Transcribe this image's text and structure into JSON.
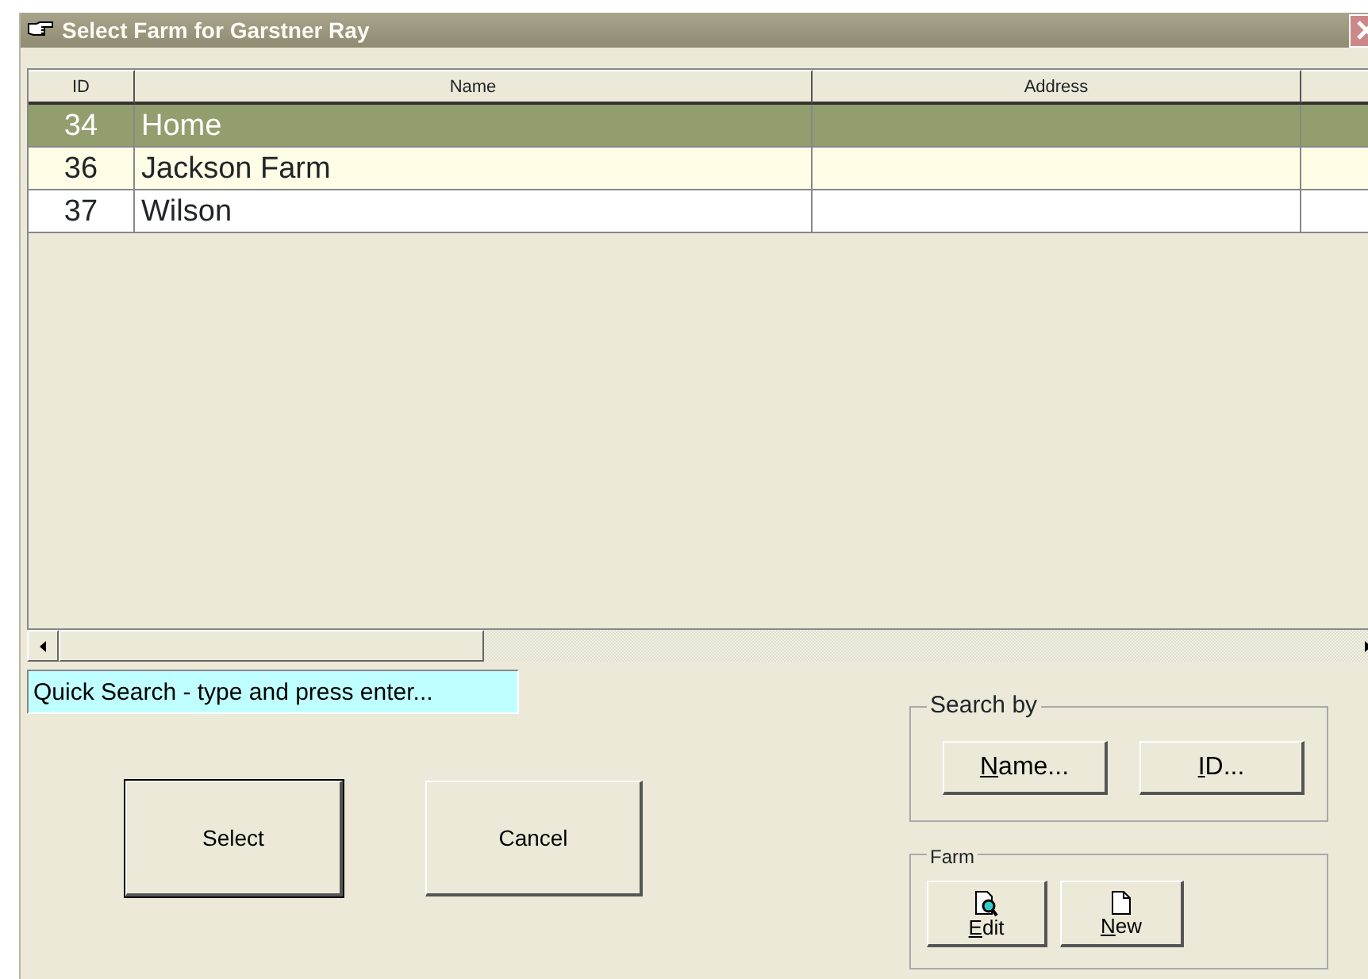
{
  "window": {
    "title": "Select Farm for Garstner  Ray"
  },
  "table": {
    "columns": [
      "ID",
      "Name",
      "Address"
    ],
    "rows": [
      {
        "cells": [
          "34",
          "Home"
        ],
        "selected": true,
        "shaded": false
      },
      {
        "cells": [
          "36",
          "Jackson Farm"
        ],
        "selected": false,
        "shaded": true
      },
      {
        "cells": [
          "37",
          "Wilson"
        ],
        "selected": false,
        "shaded": false
      }
    ]
  },
  "quick_search": {
    "value": "Quick Search - type and press enter..."
  },
  "buttons": [
    {
      "label": "Select",
      "default": true
    },
    {
      "label": "Cancel",
      "default": false
    }
  ],
  "search_by": {
    "title": "Search by",
    "buttons": [
      {
        "underlined": "N",
        "rest": "ame..."
      },
      {
        "underlined": "I",
        "rest": "D..."
      }
    ]
  },
  "farm": {
    "title": "Farm",
    "buttons": [
      {
        "kind": "edit",
        "underlined": "E",
        "rest": "dit"
      },
      {
        "kind": "new",
        "underlined": "N",
        "rest": "ew"
      }
    ]
  }
}
